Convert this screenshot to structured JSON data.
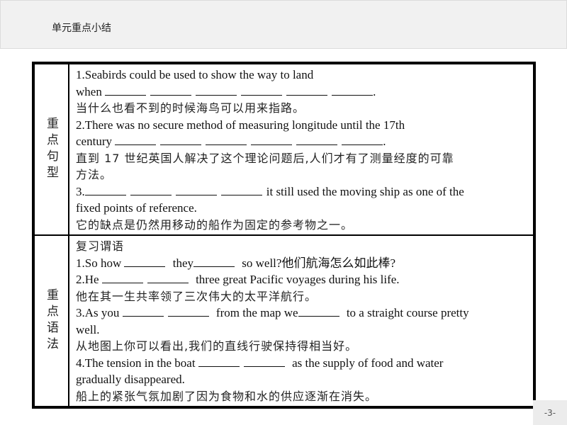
{
  "header": {
    "title": "单元重点小结"
  },
  "table": {
    "sections": [
      {
        "label": "重点句型",
        "items": {
          "s1_en_a": "1.Seabirds could be used to show the way to land",
          "s1_en_b_prefix": "when",
          "s1_en_b_suffix": ".",
          "s1_cn": "当什么也看不到的时候海鸟可以用来指路。",
          "s2_en_a": "2.There was no secure method of measuring longitude until the 17th",
          "s2_en_b_prefix": "century",
          "s2_en_b_suffix": ".",
          "s2_cn_a": "直到 17 世纪英国人解决了这个理论问题后,人们才有了测量经度的可靠",
          "s2_cn_b": "方法。",
          "s3_en_a_prefix": "3.",
          "s3_en_a_suffix": "it still used the moving ship as one of the",
          "s3_en_b": "fixed points of reference.",
          "s3_cn": "它的缺点是仍然用移动的船作为固定的参考物之一。"
        }
      },
      {
        "label": "重点语法",
        "items": {
          "heading": "复习谓语",
          "g1_p1": "1.So how",
          "g1_p2": "they",
          "g1_p3": "so well?他们航海怎么如此棒?",
          "g2_p1": "2.He",
          "g2_p2": "three great Pacific voyages during his life.",
          "g2_cn": "他在其一生共率领了三次伟大的太平洋航行。",
          "g3_p1": "3.As you",
          "g3_p2": "from the map we",
          "g3_p3": "to a straight course pretty",
          "g3_en_b": "well.",
          "g3_cn": "从地图上你可以看出,我们的直线行驶保持得相当好。",
          "g4_p1": "4.The tension in the boat",
          "g4_p2": "as the supply of food and water",
          "g4_en_b": "gradually disappeared.",
          "g4_cn": "船上的紧张气氛加剧了因为食物和水的供应逐渐在消失。"
        }
      }
    ]
  },
  "footer": {
    "page_number": "-3-"
  }
}
